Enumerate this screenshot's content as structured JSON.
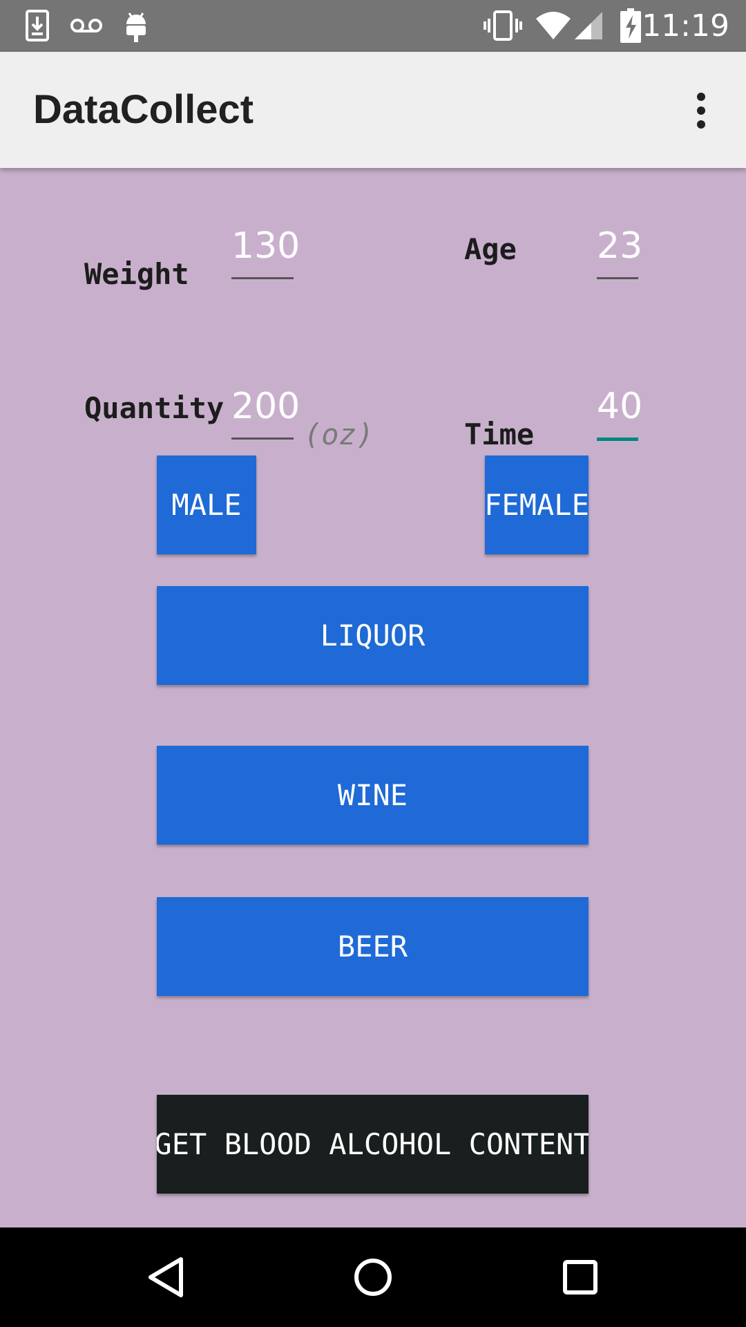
{
  "status_bar": {
    "time": "11:19",
    "icons_left": [
      "download-icon",
      "voicemail-icon",
      "android-icon"
    ],
    "icons_right": [
      "vibrate-icon",
      "wifi-icon",
      "cell-signal-icon",
      "battery-charging-icon"
    ]
  },
  "app_bar": {
    "title": "DataCollect",
    "menu_icon": "overflow-menu-icon"
  },
  "form": {
    "weight": {
      "label": "Weight",
      "value": "130"
    },
    "age": {
      "label": "Age",
      "value": "23"
    },
    "quantity": {
      "label": "Quantity",
      "value": "200",
      "unit": "(oz)"
    },
    "time": {
      "label": "Time",
      "value": "40"
    }
  },
  "buttons": {
    "male": "MALE",
    "female": "FEMALE",
    "liquor": "LIQUOR",
    "wine": "WINE",
    "beer": "BEER",
    "get_bac": "GET BLOOD ALCOHOL CONTENT"
  },
  "colors": {
    "background": "#c8b0cc",
    "button": "#1f6ad6",
    "primary_action": "#181f1e",
    "focus_underline": "#00897b"
  },
  "nav_bar": {
    "icons": [
      "back-icon",
      "home-icon",
      "recents-icon"
    ]
  }
}
